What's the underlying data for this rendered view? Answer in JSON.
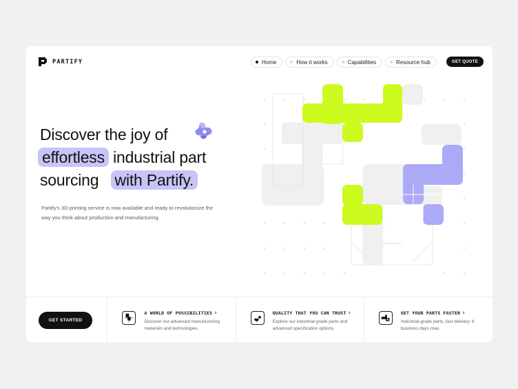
{
  "brand": {
    "name": "PARTIFY"
  },
  "nav": {
    "items": [
      {
        "label": "Home",
        "active": true
      },
      {
        "label": "How it works",
        "active": false
      },
      {
        "label": "Capabilities",
        "active": false
      },
      {
        "label": "Resource hub",
        "active": false
      }
    ],
    "cta": "GET QUOTE"
  },
  "hero": {
    "line1": "Discover the joy of",
    "line2_highlight": "effortless",
    "line2_rest": "industrial part",
    "line3_rest": "sourcing",
    "line3_highlight": "with Partify.",
    "description": "Partify's 3D printing service is now available and ready to revolutionize the way you think about production and manufacturing."
  },
  "footer": {
    "cta": "GET STARTED",
    "features": [
      {
        "title": "A WORLD OF POSSIBILITIES",
        "desc": "Discover our advanced manufacturing materials and technologies.",
        "icon": "grid-part-icon"
      },
      {
        "title": "QUALITY THAT YOU CAN TRUST",
        "desc": "Explore our industrial-grade parts and advanced specification options.",
        "icon": "check-part-icon"
      },
      {
        "title": "GET YOUR PARTS FASTER",
        "desc": "Industrial-grade parts, fast delivery: 6 business days max.",
        "icon": "fast-part-icon"
      }
    ]
  },
  "colors": {
    "lime": "#cdfb1f",
    "lavender": "#acaaf7",
    "highlight": "#c7c5f7",
    "gray": "#f0f0f0",
    "dark": "#111111"
  }
}
